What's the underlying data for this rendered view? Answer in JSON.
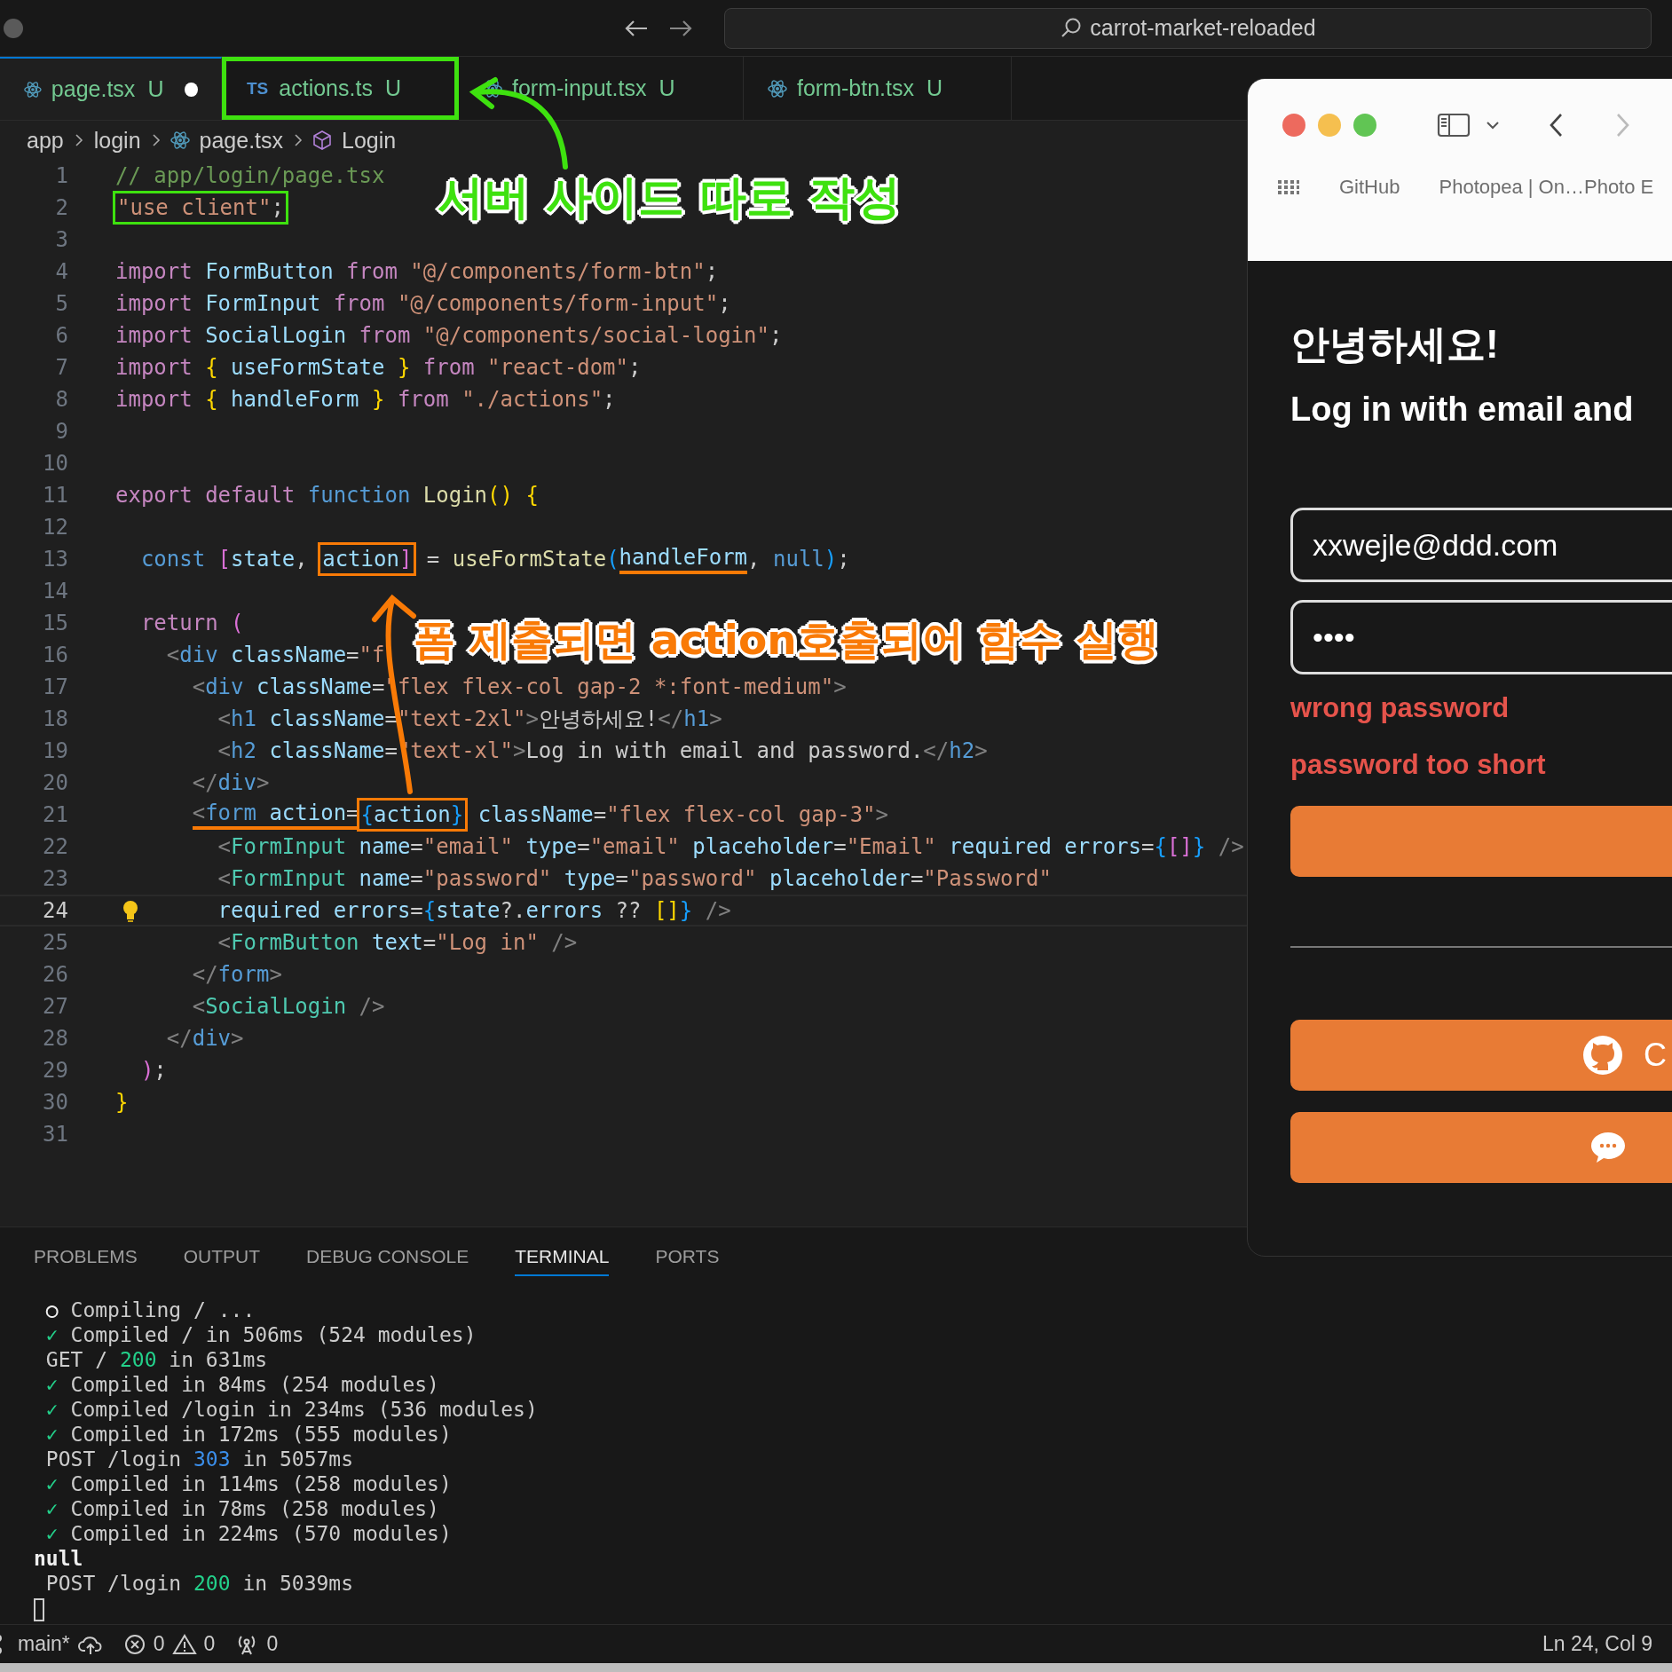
{
  "titlebar": {
    "search": "carrot-market-reloaded"
  },
  "tabs": [
    {
      "label": "page.tsx",
      "status": "U",
      "kind": "react",
      "selected": true,
      "modified": true,
      "highlighted": false
    },
    {
      "label": "actions.ts",
      "status": "U",
      "kind": "ts",
      "icon_text": "TS",
      "selected": false,
      "modified": false,
      "highlighted": true,
      "color": "#3ee10f"
    },
    {
      "label": "form-input.tsx",
      "status": "U",
      "kind": "react",
      "selected": false,
      "modified": false,
      "highlighted": false
    },
    {
      "label": "form-btn.tsx",
      "status": "U",
      "kind": "react",
      "selected": false,
      "modified": false,
      "highlighted": false
    }
  ],
  "breadcrumbs": [
    {
      "label": "app",
      "kind": "folder"
    },
    {
      "label": "login",
      "kind": "folder"
    },
    {
      "label": "page.tsx",
      "kind": "file"
    },
    {
      "label": "Login",
      "kind": "component"
    }
  ],
  "editor": {
    "lines": [
      {
        "number": "1",
        "current": false,
        "segments": [
          {
            "kind": "text",
            "tokens": [
              {
                "text": "// app/login/page.tsx",
                "kind": "comment"
              }
            ]
          }
        ]
      },
      {
        "number": "2",
        "current": false,
        "segments": [
          {
            "kind": "box",
            "color": "#3ee10f",
            "tokens": [
              {
                "text": "\"use client\"",
                "kind": "string"
              },
              {
                "text": ";",
                "kind": "plain"
              }
            ]
          }
        ]
      },
      {
        "number": "3",
        "current": false
      },
      {
        "number": "4",
        "current": false,
        "segments": [
          {
            "kind": "text",
            "tokens": [
              {
                "text": "import ",
                "kind": "keyword"
              },
              {
                "text": "FormButton ",
                "kind": "variable"
              },
              {
                "text": "from ",
                "kind": "keyword"
              },
              {
                "text": "\"@/components/form-btn\"",
                "kind": "string"
              },
              {
                "text": ";",
                "kind": "plain"
              }
            ]
          }
        ]
      },
      {
        "number": "5",
        "current": false,
        "segments": [
          {
            "kind": "text",
            "tokens": [
              {
                "text": "import ",
                "kind": "keyword"
              },
              {
                "text": "FormInput ",
                "kind": "variable"
              },
              {
                "text": "from ",
                "kind": "keyword"
              },
              {
                "text": "\"@/components/form-input\"",
                "kind": "string"
              },
              {
                "text": ";",
                "kind": "plain"
              }
            ]
          }
        ]
      },
      {
        "number": "6",
        "current": false,
        "segments": [
          {
            "kind": "text",
            "tokens": [
              {
                "text": "import ",
                "kind": "keyword"
              },
              {
                "text": "SocialLogin ",
                "kind": "variable"
              },
              {
                "text": "from ",
                "kind": "keyword"
              },
              {
                "text": "\"@/components/social-login\"",
                "kind": "string"
              },
              {
                "text": ";",
                "kind": "plain"
              }
            ]
          }
        ]
      },
      {
        "number": "7",
        "current": false,
        "segments": [
          {
            "kind": "text",
            "tokens": [
              {
                "text": "import ",
                "kind": "keyword"
              },
              {
                "text": "{",
                "kind": "bracket1"
              },
              {
                "text": " useFormState ",
                "kind": "variable"
              },
              {
                "text": "}",
                "kind": "bracket1"
              },
              {
                "text": " from ",
                "kind": "keyword"
              },
              {
                "text": "\"react-dom\"",
                "kind": "string"
              },
              {
                "text": ";",
                "kind": "plain"
              }
            ]
          }
        ]
      },
      {
        "number": "8",
        "current": false,
        "segments": [
          {
            "kind": "text",
            "tokens": [
              {
                "text": "import ",
                "kind": "keyword"
              },
              {
                "text": "{",
                "kind": "bracket1"
              },
              {
                "text": " handleForm ",
                "kind": "variable"
              },
              {
                "text": "}",
                "kind": "bracket1"
              },
              {
                "text": " from ",
                "kind": "keyword"
              },
              {
                "text": "\"./actions\"",
                "kind": "string"
              },
              {
                "text": ";",
                "kind": "plain"
              }
            ]
          }
        ]
      },
      {
        "number": "9",
        "current": false
      },
      {
        "number": "10",
        "current": false
      },
      {
        "number": "11",
        "current": false,
        "segments": [
          {
            "kind": "text",
            "tokens": [
              {
                "text": "export default ",
                "kind": "keyword"
              },
              {
                "text": "function ",
                "kind": "storage"
              },
              {
                "text": "Login",
                "kind": "function"
              },
              {
                "text": "() ",
                "kind": "bracket1"
              },
              {
                "text": "{",
                "kind": "bracket1"
              }
            ]
          }
        ]
      },
      {
        "number": "12",
        "current": false
      },
      {
        "number": "13",
        "current": false,
        "segments": [
          {
            "kind": "text",
            "tokens": [
              {
                "text": "  const ",
                "kind": "storage"
              },
              {
                "text": "[",
                "kind": "bracket2"
              },
              {
                "text": "state",
                "kind": "variable"
              },
              {
                "text": ", ",
                "kind": "plain"
              }
            ]
          },
          {
            "kind": "box",
            "color": "#f97a06",
            "tokens": [
              {
                "text": "action",
                "kind": "variable"
              },
              {
                "text": "]",
                "kind": "bracket2"
              }
            ]
          },
          {
            "kind": "text",
            "tokens": [
              {
                "text": " = ",
                "kind": "plain"
              },
              {
                "text": "useFormState",
                "kind": "function"
              },
              {
                "text": "(",
                "kind": "bracket3"
              }
            ]
          },
          {
            "kind": "underline",
            "color": "#f97a06",
            "tokens": [
              {
                "text": "handleForm",
                "kind": "variable"
              }
            ]
          },
          {
            "kind": "text",
            "tokens": [
              {
                "text": ", ",
                "kind": "plain"
              },
              {
                "text": "null",
                "kind": "storage"
              },
              {
                "text": ")",
                "kind": "bracket3"
              },
              {
                "text": ";",
                "kind": "plain"
              }
            ]
          }
        ]
      },
      {
        "number": "14",
        "current": false
      },
      {
        "number": "15",
        "current": false,
        "segments": [
          {
            "kind": "text",
            "tokens": [
              {
                "text": "  return ",
                "kind": "keyword"
              },
              {
                "text": "(",
                "kind": "bracket2"
              }
            ]
          }
        ]
      },
      {
        "number": "16",
        "current": false,
        "segments": [
          {
            "kind": "text",
            "tokens": [
              {
                "text": "    <",
                "kind": "punct"
              },
              {
                "text": "div ",
                "kind": "tag"
              },
              {
                "text": "className",
                "kind": "variable"
              },
              {
                "text": "=",
                "kind": "plain"
              },
              {
                "text": "\"f",
                "kind": "string"
              }
            ]
          }
        ]
      },
      {
        "number": "17",
        "current": false,
        "segments": [
          {
            "kind": "text",
            "tokens": [
              {
                "text": "      <",
                "kind": "punct"
              },
              {
                "text": "div ",
                "kind": "tag"
              },
              {
                "text": "className",
                "kind": "variable"
              },
              {
                "text": "=",
                "kind": "plain"
              },
              {
                "text": "\"flex flex-col gap-2 *:font-medium\"",
                "kind": "string"
              },
              {
                "text": ">",
                "kind": "punct"
              }
            ]
          }
        ]
      },
      {
        "number": "18",
        "current": false,
        "segments": [
          {
            "kind": "text",
            "tokens": [
              {
                "text": "        <",
                "kind": "punct"
              },
              {
                "text": "h1 ",
                "kind": "tag"
              },
              {
                "text": "className",
                "kind": "variable"
              },
              {
                "text": "=",
                "kind": "plain"
              },
              {
                "text": "\"text-2xl\"",
                "kind": "string"
              },
              {
                "text": ">",
                "kind": "punct"
              },
              {
                "text": "안녕하세요!",
                "kind": "plain"
              },
              {
                "text": "</",
                "kind": "punct"
              },
              {
                "text": "h1",
                "kind": "tag"
              },
              {
                "text": ">",
                "kind": "punct"
              }
            ]
          }
        ]
      },
      {
        "number": "19",
        "current": false,
        "segments": [
          {
            "kind": "text",
            "tokens": [
              {
                "text": "        <",
                "kind": "punct"
              },
              {
                "text": "h2 ",
                "kind": "tag"
              },
              {
                "text": "className",
                "kind": "variable"
              },
              {
                "text": "=",
                "kind": "plain"
              },
              {
                "text": "\"text-xl\"",
                "kind": "string"
              },
              {
                "text": ">",
                "kind": "punct"
              },
              {
                "text": "Log in with email and password.",
                "kind": "plain"
              },
              {
                "text": "</",
                "kind": "punct"
              },
              {
                "text": "h2",
                "kind": "tag"
              },
              {
                "text": ">",
                "kind": "punct"
              }
            ]
          }
        ]
      },
      {
        "number": "20",
        "current": false,
        "segments": [
          {
            "kind": "text",
            "tokens": [
              {
                "text": "      </",
                "kind": "punct"
              },
              {
                "text": "div",
                "kind": "tag"
              },
              {
                "text": ">",
                "kind": "punct"
              }
            ]
          }
        ]
      },
      {
        "number": "21",
        "current": false,
        "segments": [
          {
            "kind": "underline",
            "color": "#f97a06",
            "tokens": [
              {
                "text": "      <",
                "kind": "punct"
              },
              {
                "text": "form ",
                "kind": "tag"
              },
              {
                "text": "action",
                "kind": "variable"
              },
              {
                "text": "=",
                "kind": "plain"
              }
            ]
          },
          {
            "kind": "box",
            "color": "#f97a06",
            "tokens": [
              {
                "text": "{",
                "kind": "bracket3"
              },
              {
                "text": "action",
                "kind": "variable"
              },
              {
                "text": "}",
                "kind": "bracket3"
              }
            ]
          },
          {
            "kind": "text",
            "tokens": [
              {
                "text": " className",
                "kind": "variable"
              },
              {
                "text": "=",
                "kind": "plain"
              },
              {
                "text": "\"flex flex-col gap-3\"",
                "kind": "string"
              },
              {
                "text": ">",
                "kind": "punct"
              }
            ]
          }
        ]
      },
      {
        "number": "22",
        "current": false,
        "segments": [
          {
            "kind": "text",
            "tokens": [
              {
                "text": "        <",
                "kind": "punct"
              },
              {
                "text": "FormInput ",
                "kind": "component"
              },
              {
                "text": "name",
                "kind": "variable"
              },
              {
                "text": "=",
                "kind": "plain"
              },
              {
                "text": "\"email\"",
                "kind": "string"
              },
              {
                "text": " type",
                "kind": "variable"
              },
              {
                "text": "=",
                "kind": "plain"
              },
              {
                "text": "\"email\"",
                "kind": "string"
              },
              {
                "text": " placeholder",
                "kind": "variable"
              },
              {
                "text": "=",
                "kind": "plain"
              },
              {
                "text": "\"Email\"",
                "kind": "string"
              },
              {
                "text": " required errors",
                "kind": "variable"
              },
              {
                "text": "=",
                "kind": "plain"
              },
              {
                "text": "{",
                "kind": "bracket3"
              },
              {
                "text": "[]",
                "kind": "bracket2"
              },
              {
                "text": "}",
                "kind": "bracket3"
              },
              {
                "text": " />",
                "kind": "punct"
              }
            ]
          }
        ]
      },
      {
        "number": "23",
        "current": false,
        "segments": [
          {
            "kind": "text",
            "tokens": [
              {
                "text": "        <",
                "kind": "punct"
              },
              {
                "text": "FormInput ",
                "kind": "component"
              },
              {
                "text": "name",
                "kind": "variable"
              },
              {
                "text": "=",
                "kind": "plain"
              },
              {
                "text": "\"password\"",
                "kind": "string"
              },
              {
                "text": " type",
                "kind": "variable"
              },
              {
                "text": "=",
                "kind": "plain"
              },
              {
                "text": "\"password\"",
                "kind": "string"
              },
              {
                "text": " placeholder",
                "kind": "variable"
              },
              {
                "text": "=",
                "kind": "plain"
              },
              {
                "text": "\"Password\"",
                "kind": "string"
              }
            ]
          }
        ]
      },
      {
        "number": "24",
        "current": true,
        "segments": [
          {
            "kind": "text",
            "tokens": [
              {
                "text": "        required errors",
                "kind": "variable"
              },
              {
                "text": "=",
                "kind": "plain"
              },
              {
                "text": "{",
                "kind": "bracket3"
              },
              {
                "text": "state",
                "kind": "variable"
              },
              {
                "text": "?.",
                "kind": "plain"
              },
              {
                "text": "errors",
                "kind": "variable"
              },
              {
                "text": " ?? ",
                "kind": "plain"
              },
              {
                "text": "[]",
                "kind": "bracket1"
              },
              {
                "text": "}",
                "kind": "bracket3"
              },
              {
                "text": " />",
                "kind": "punct"
              }
            ]
          }
        ]
      },
      {
        "number": "25",
        "current": false,
        "segments": [
          {
            "kind": "text",
            "tokens": [
              {
                "text": "        <",
                "kind": "punct"
              },
              {
                "text": "FormButton ",
                "kind": "component"
              },
              {
                "text": "text",
                "kind": "variable"
              },
              {
                "text": "=",
                "kind": "plain"
              },
              {
                "text": "\"Log in\"",
                "kind": "string"
              },
              {
                "text": " />",
                "kind": "punct"
              }
            ]
          }
        ]
      },
      {
        "number": "26",
        "current": false,
        "segments": [
          {
            "kind": "text",
            "tokens": [
              {
                "text": "      </",
                "kind": "punct"
              },
              {
                "text": "form",
                "kind": "tag"
              },
              {
                "text": ">",
                "kind": "punct"
              }
            ]
          }
        ]
      },
      {
        "number": "27",
        "current": false,
        "segments": [
          {
            "kind": "text",
            "tokens": [
              {
                "text": "      <",
                "kind": "punct"
              },
              {
                "text": "SocialLogin ",
                "kind": "component"
              },
              {
                "text": "/>",
                "kind": "punct"
              }
            ]
          }
        ]
      },
      {
        "number": "28",
        "current": false,
        "segments": [
          {
            "kind": "text",
            "tokens": [
              {
                "text": "    </",
                "kind": "punct"
              },
              {
                "text": "div",
                "kind": "tag"
              },
              {
                "text": ">",
                "kind": "punct"
              }
            ]
          }
        ]
      },
      {
        "number": "29",
        "current": false,
        "segments": [
          {
            "kind": "text",
            "tokens": [
              {
                "text": "  )",
                "kind": "bracket2"
              },
              {
                "text": ";",
                "kind": "plain"
              }
            ]
          }
        ]
      },
      {
        "number": "30",
        "current": false,
        "segments": [
          {
            "kind": "text",
            "tokens": [
              {
                "text": "}",
                "kind": "bracket1"
              }
            ]
          }
        ]
      },
      {
        "number": "31",
        "current": false
      }
    ]
  },
  "annotations": [
    {
      "text": "서버 사이드 따로 작성",
      "color": "#3ee10f"
    },
    {
      "text": "폼 제출되면 action호출되어 함수 실행",
      "color": "#f97a06"
    }
  ],
  "browser": {
    "bookmarks": [
      {
        "label": "GitHub"
      },
      {
        "label": "Photopea | On…Photo E"
      }
    ],
    "page": {
      "heading": "안녕하세요!",
      "subheading": "Log in with email and",
      "fields": [
        {
          "value": "xxwejle@ddd.com"
        },
        {
          "value": "••••"
        }
      ],
      "errors": [
        "wrong password",
        "password too short"
      ],
      "form_buttons": [
        {
          "kind": "submit"
        }
      ],
      "social_buttons": [
        {
          "kind": "github",
          "label": "C"
        },
        {
          "kind": "chat"
        }
      ]
    }
  },
  "panel": {
    "tabs": [
      {
        "label": "PROBLEMS",
        "selected": false
      },
      {
        "label": "OUTPUT",
        "selected": false
      },
      {
        "label": "DEBUG CONSOLE",
        "selected": false
      },
      {
        "label": "TERMINAL",
        "selected": true
      },
      {
        "label": "PORTS",
        "selected": false
      }
    ],
    "terminal": [
      {
        "tokens": [
          {
            "text": " ○",
            "kind": "bold"
          },
          {
            "text": " Compiling / ...",
            "kind": "plain"
          }
        ]
      },
      {
        "tokens": [
          {
            "text": " ✓",
            "kind": "ok"
          },
          {
            "text": " Compiled / in 506ms (524 modules)",
            "kind": "plain"
          }
        ]
      },
      {
        "tokens": [
          {
            "text": " GET / ",
            "kind": "plain"
          },
          {
            "text": "200",
            "kind": "ok"
          },
          {
            "text": " in 631ms",
            "kind": "plain"
          }
        ]
      },
      {
        "tokens": [
          {
            "text": " ✓",
            "kind": "ok"
          },
          {
            "text": " Compiled in 84ms (254 modules)",
            "kind": "plain"
          }
        ]
      },
      {
        "tokens": [
          {
            "text": " ✓",
            "kind": "ok"
          },
          {
            "text": " Compiled /login in 234ms (536 modules)",
            "kind": "plain"
          }
        ]
      },
      {
        "tokens": [
          {
            "text": " ✓",
            "kind": "ok"
          },
          {
            "text": " Compiled in 172ms (555 modules)",
            "kind": "plain"
          }
        ]
      },
      {
        "tokens": [
          {
            "text": " POST /login ",
            "kind": "plain"
          },
          {
            "text": "303",
            "kind": "info"
          },
          {
            "text": " in 5057ms",
            "kind": "plain"
          }
        ]
      },
      {
        "tokens": [
          {
            "text": " ✓",
            "kind": "ok"
          },
          {
            "text": " Compiled in 114ms (258 modules)",
            "kind": "plain"
          }
        ]
      },
      {
        "tokens": [
          {
            "text": " ✓",
            "kind": "ok"
          },
          {
            "text": " Compiled in 78ms (258 modules)",
            "kind": "plain"
          }
        ]
      },
      {
        "tokens": [
          {
            "text": " ✓",
            "kind": "ok"
          },
          {
            "text": " Compiled in 224ms (570 modules)",
            "kind": "plain"
          }
        ]
      },
      {
        "tokens": [
          {
            "text": "null",
            "kind": "bold"
          }
        ]
      },
      {
        "tokens": [
          {
            "text": " POST /login ",
            "kind": "plain"
          },
          {
            "text": "200",
            "kind": "ok"
          },
          {
            "text": " in 5039ms",
            "kind": "plain"
          }
        ]
      }
    ]
  },
  "status_bar": {
    "branch": "main*",
    "errors": "0",
    "warnings": "0",
    "ports": "0",
    "cursor": "Ln 24, Col 9"
  }
}
